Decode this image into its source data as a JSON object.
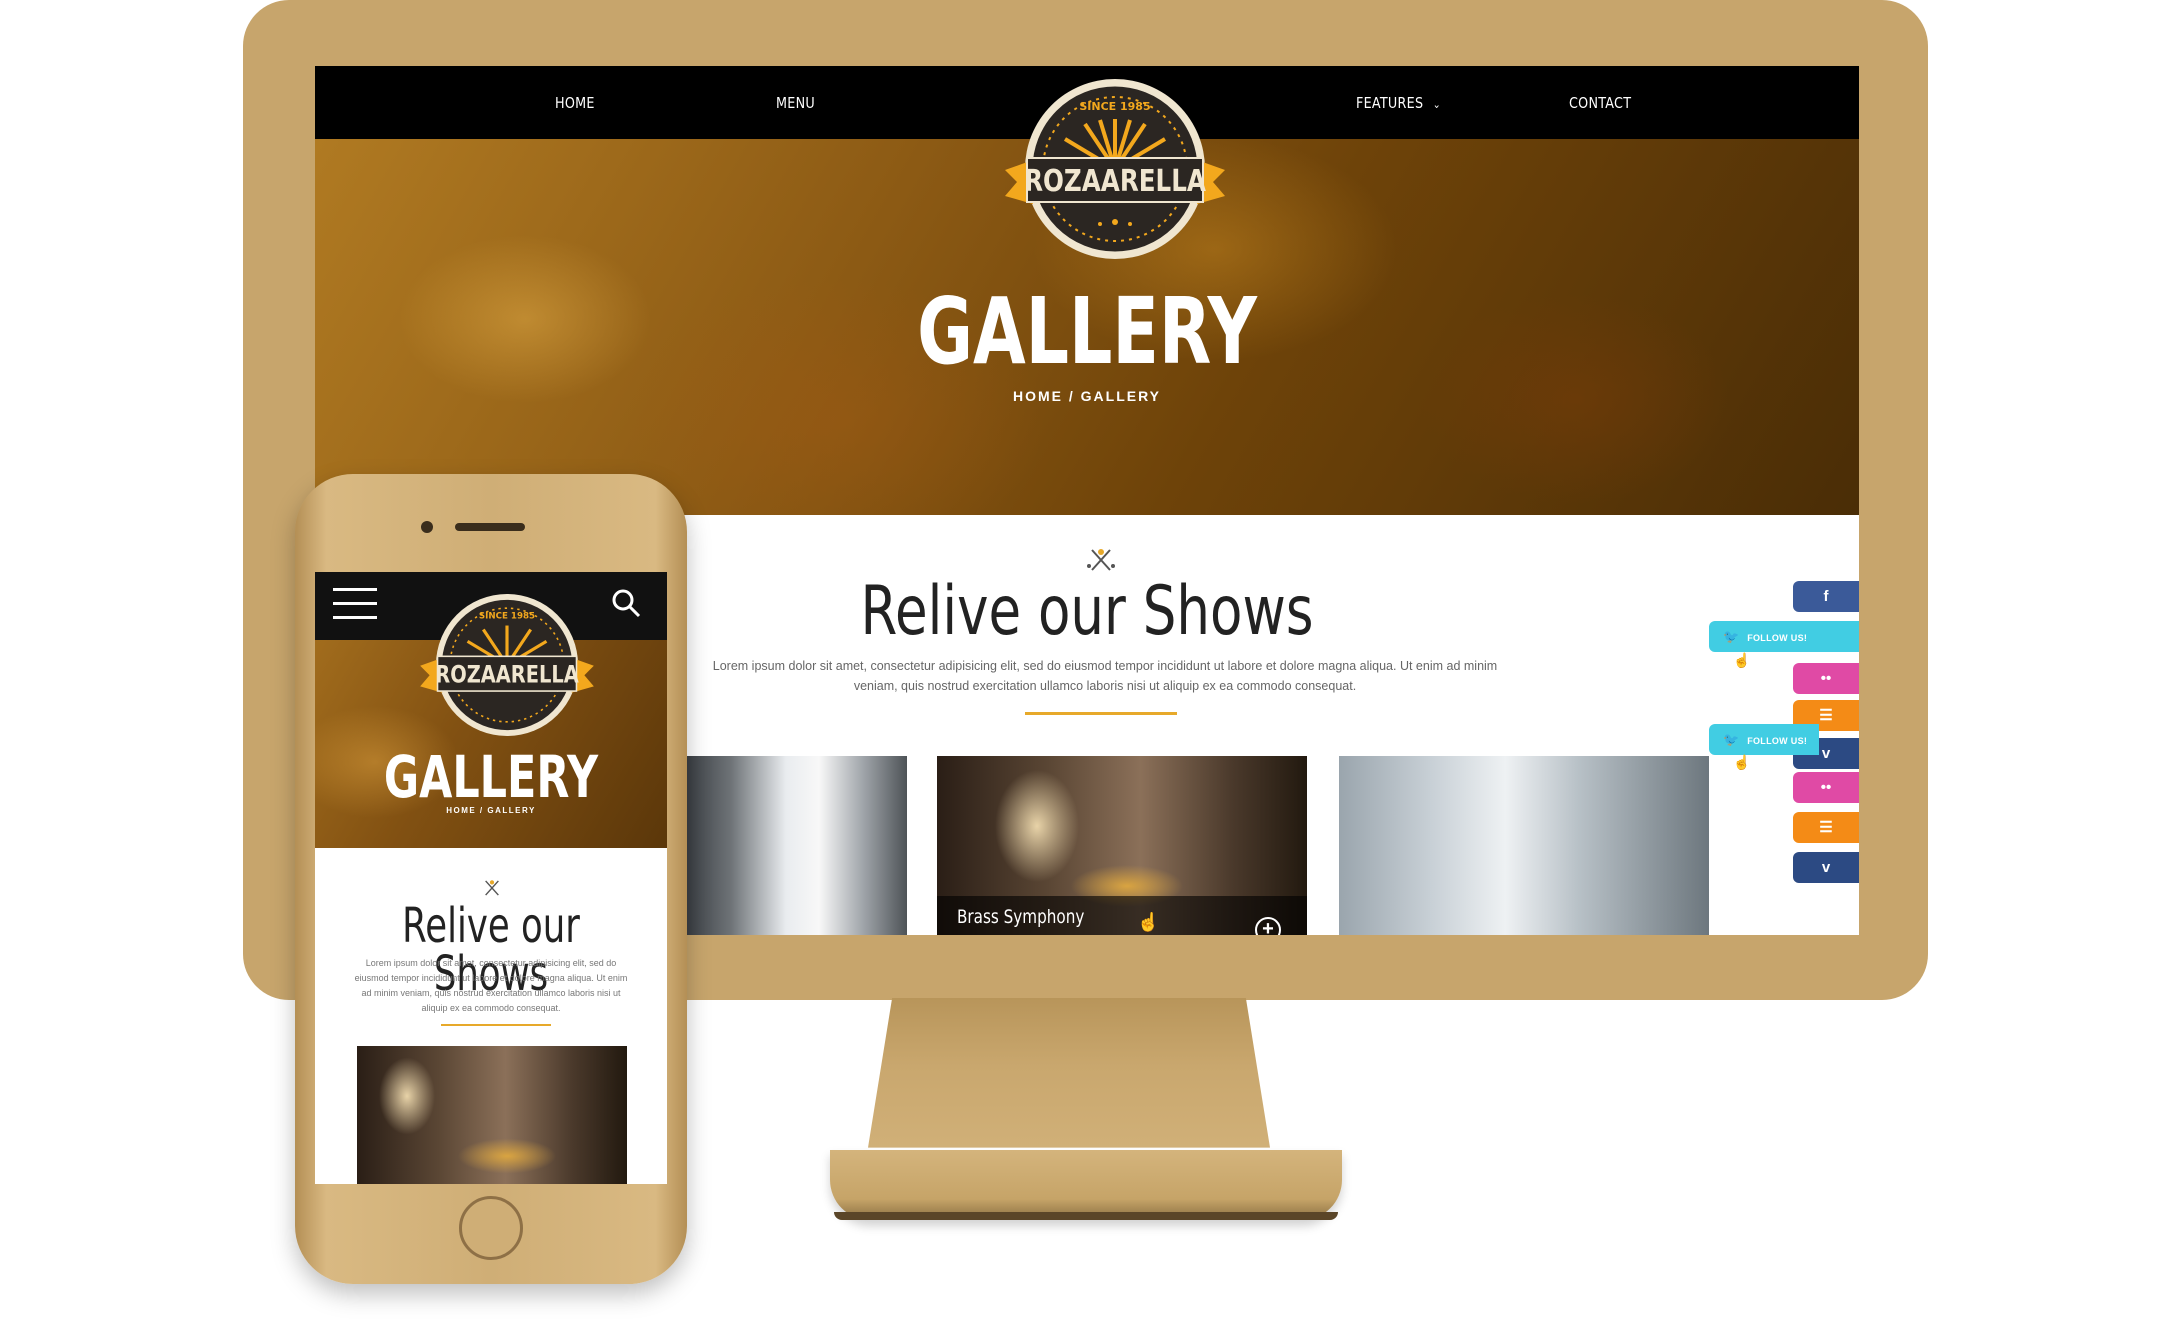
{
  "desktop": {
    "nav": {
      "home": "HOME",
      "menu": "MENU",
      "features": "FEATURES",
      "features_arrow": "⌄",
      "contact": "CONTACT"
    },
    "logo": {
      "since": "SINCE 1985",
      "name": "ROZAARELLA"
    },
    "hero": {
      "title": "GALLERY",
      "breadcrumb": "HOME / GALLERY"
    },
    "section": {
      "title": "Relive our Shows",
      "text": "Lorem ipsum dolor sit amet, consectetur adipisicing elit, sed do eiusmod tempor incididunt ut labore et dolore magna aliqua. Ut enim ad minim veniam, quis nostrud exercitation ullamco laboris nisi ut aliquip ex ea commodo consequat."
    },
    "gallery": {
      "brass_caption": "Brass Symphony",
      "plus": "+"
    },
    "social": {
      "facebook": "f",
      "follow_label": "FOLLOW US!",
      "flickr": "••",
      "rss": "☰",
      "vimeo": "v"
    }
  },
  "mobile": {
    "logo": {
      "since": "SINCE 1985",
      "name": "ROZAARELLA"
    },
    "hero": {
      "title": "GALLERY",
      "breadcrumb": "HOME / GALLERY"
    },
    "section": {
      "title": "Relive our Shows",
      "text": "Lorem ipsum dolor sit amet, consectetur adipisicing elit, sed do eiusmod tempor incididunt ut labore et dolore magna aliqua. Ut enim ad minim veniam, quis nostrud exercitation ullamco laboris nisi ut aliquip ex ea commodo consequat."
    }
  },
  "colors": {
    "device_gold": "#c7a56c",
    "accent_orange": "#e7a92a",
    "facebook": "#3b5a99",
    "twitter": "#41cde3",
    "flickr": "#e04aa5",
    "rss": "#f48b16",
    "vimeo": "#2c4a83"
  },
  "icons": {
    "logo": "rozaarella-badge-logo",
    "ornament": "cross-ornament-icon",
    "search": "search-icon",
    "menu": "hamburger-icon",
    "cursor": "hand-cursor-icon"
  }
}
